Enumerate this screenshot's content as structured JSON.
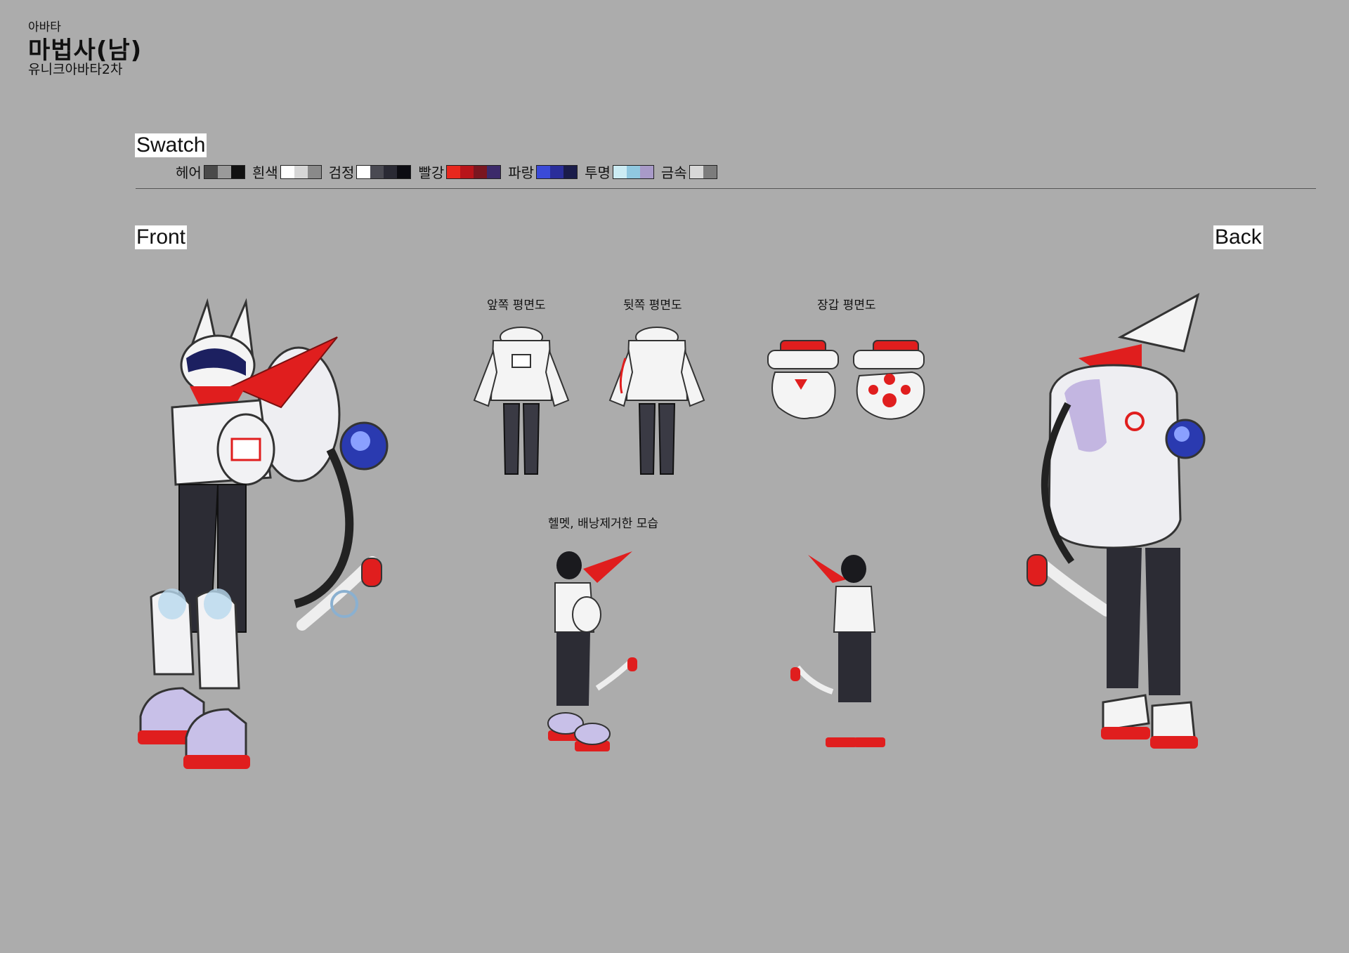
{
  "header": {
    "category": "아바타",
    "title": "마법사(남)",
    "subtitle": "유니크아바타2차"
  },
  "swatch": {
    "heading": "Swatch",
    "groups": [
      {
        "name": "헤어",
        "colors": [
          "#4a4a4a",
          "#9a9a9a",
          "#111111"
        ]
      },
      {
        "name": "흰색",
        "colors": [
          "#ffffff",
          "#d6d6d6",
          "#8a8a8a"
        ]
      },
      {
        "name": "검정",
        "colors": [
          "#ffffff",
          "#4a4a52",
          "#2a2a34",
          "#0c0c12"
        ]
      },
      {
        "name": "빨강",
        "colors": [
          "#e8281e",
          "#b8141a",
          "#7a1620",
          "#3c2a6a"
        ]
      },
      {
        "name": "파랑",
        "colors": [
          "#3a4ad8",
          "#2a2e9a",
          "#1a1c4a"
        ]
      },
      {
        "name": "투명",
        "colors": [
          "#ccecf4",
          "#90c8e0",
          "#a89ac8"
        ]
      },
      {
        "name": "금속",
        "colors": [
          "#d8d8d8",
          "#7c7c7c"
        ]
      }
    ]
  },
  "views": {
    "front_label": "Front",
    "back_label": "Back"
  },
  "captions": {
    "front_flat": "앞쪽 평면도",
    "back_flat": "뒷쪽 평면도",
    "glove_flat": "장갑 평면도",
    "no_helmet": "헬멧, 배낭제거한 모습"
  },
  "colors": {
    "background": "#acacac",
    "white": "#f2f2f4",
    "red": "#e01e1e",
    "black": "#2c2c34",
    "blue": "#3040c8",
    "glass": "#b8d8ee"
  }
}
